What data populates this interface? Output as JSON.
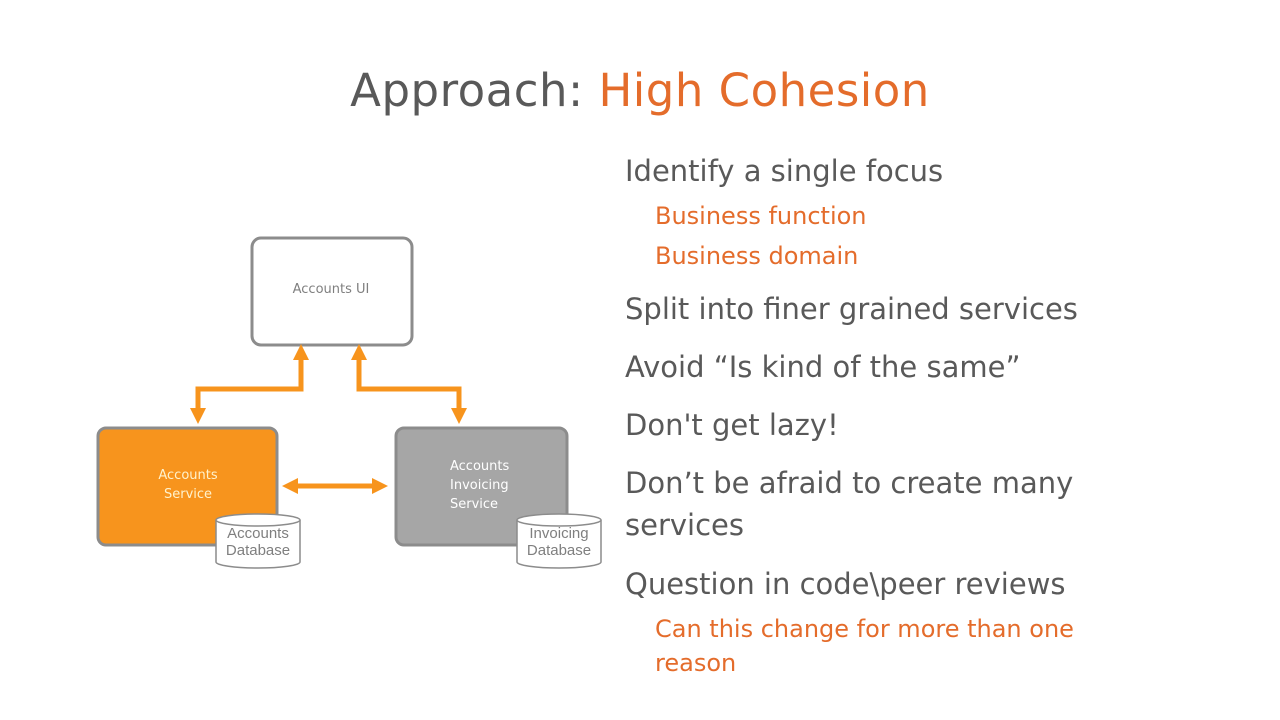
{
  "slide": {
    "title": {
      "prefix": "Approach: ",
      "highlight": "High Cohesion"
    },
    "bullets": [
      {
        "text": "Identify a single focus",
        "level": 1
      },
      {
        "text": "Business function",
        "level": 2
      },
      {
        "text": "Business domain",
        "level": 2
      },
      {
        "text": "Split into finer grained services",
        "level": 1
      },
      {
        "text": "Avoid “Is kind of the same”",
        "level": 1
      },
      {
        "text": "Don't get lazy!",
        "level": 1
      },
      {
        "text": "Don’t be afraid to create many",
        "level": 1
      },
      {
        "text": "services",
        "level": 1
      },
      {
        "text": "Question in code\\peer reviews",
        "level": 1
      },
      {
        "text": "Can this change for more than one",
        "level": 2
      },
      {
        "text": "reason",
        "level": 2
      }
    ]
  },
  "diagram": {
    "nodes": {
      "accounts_ui": {
        "label": "Accounts UI"
      },
      "accounts_service": {
        "line1": "Accounts",
        "line2": "Service"
      },
      "invoicing_service": {
        "line1": "Accounts",
        "line2": "Invoicing",
        "line3": "Service"
      },
      "accounts_db": {
        "line1": "Accounts",
        "line2": "Database"
      },
      "invoicing_db": {
        "line1": "Invoicing",
        "line2": "Database"
      }
    },
    "edges": [
      {
        "from": "accounts_ui",
        "to": "accounts_service",
        "direction": "bidirectional"
      },
      {
        "from": "accounts_ui",
        "to": "invoicing_service",
        "direction": "bidirectional"
      },
      {
        "from": "accounts_service",
        "to": "invoicing_service",
        "direction": "bidirectional"
      }
    ]
  },
  "colors": {
    "title_text": "#595959",
    "accent": "#E46C2B",
    "arrow": "#F7941D",
    "service_fill": "#F7941D",
    "invoicing_fill": "#A6A6A6",
    "border": "#8C8C8C"
  }
}
